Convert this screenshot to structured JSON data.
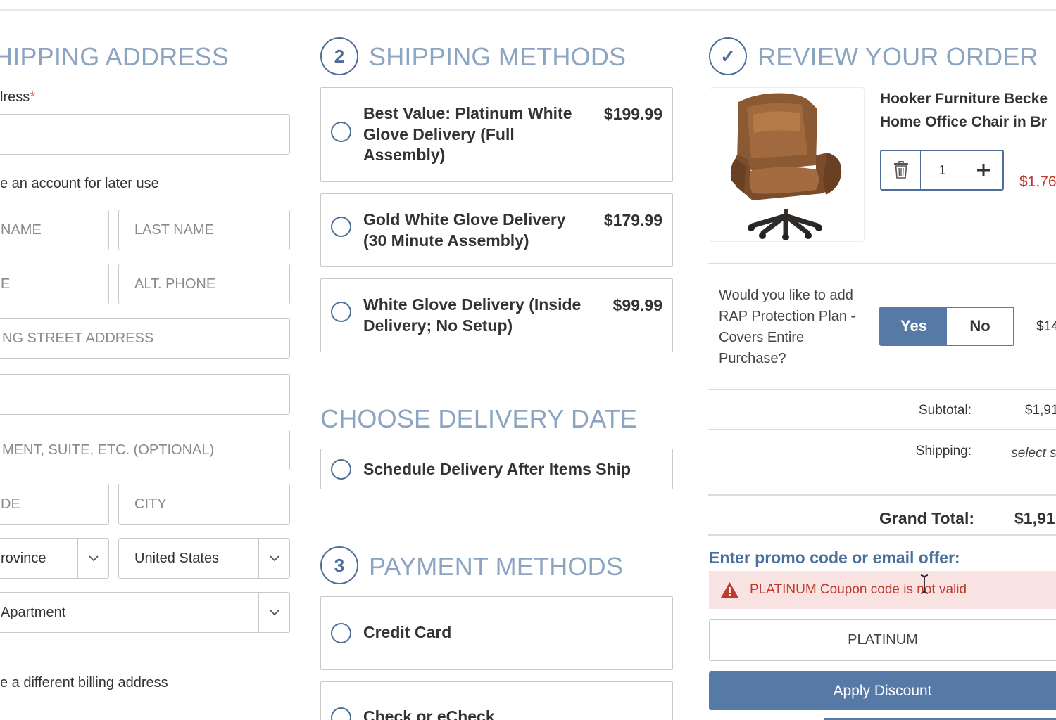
{
  "shipping_address": {
    "heading": "HIPPING ADDRESS",
    "address_label": "lress",
    "required_mark": "*",
    "address_value": "",
    "create_account_text": "e an account for later use",
    "first_name_placeholder": "NAME",
    "last_name_placeholder": "LAST NAME",
    "phone_placeholder": "E",
    "alt_phone_placeholder": "ALT. PHONE",
    "street_placeholder": "NG STREET ADDRESS",
    "street2_value": "",
    "apt_placeholder": "MENT, SUITE, ETC. (OPTIONAL)",
    "zip_placeholder": "DE",
    "city_placeholder": "CITY",
    "state_value": "rovince",
    "country_value": "United States",
    "address_type_value": "Apartment",
    "billing_text": "e a different billing address"
  },
  "shipping_methods": {
    "step": "2",
    "heading": "SHIPPING METHODS",
    "options": [
      {
        "label": "Best Value: Platinum White Glove Delivery (Full Assembly)",
        "price": "$199.99"
      },
      {
        "label": "Gold White Glove Delivery (30 Minute Assembly)",
        "price": "$179.99"
      },
      {
        "label": "White Glove Delivery (Inside Delivery; No Setup)",
        "price": "$99.99"
      }
    ]
  },
  "delivery_date": {
    "heading": "CHOOSE DELIVERY DATE",
    "option": "Schedule Delivery After Items Ship"
  },
  "payment_methods": {
    "step": "3",
    "heading": "PAYMENT METHODS",
    "options": [
      "Credit Card",
      "Check or eCheck"
    ]
  },
  "review": {
    "step": "✓",
    "heading": "REVIEW YOUR ORDER",
    "product_name_line1": "Hooker Furniture Becke",
    "product_name_line2": "Home Office Chair in Br",
    "quantity": "1",
    "product_price": "$1,76",
    "rap_question": "Would you like to add RAP Protection Plan - Covers Entire Purchase?",
    "yes_label": "Yes",
    "no_label": "No",
    "rap_price": "$14",
    "subtotal_label": "Subtotal:",
    "subtotal_value": "$1,91",
    "shipping_label": "Shipping:",
    "shipping_value": "select ship me",
    "grand_total_label": "Grand Total:",
    "grand_total_value": "$1,91",
    "promo_label": "Enter promo code or email offer:",
    "error_text": "PLATINUM Coupon code is not valid",
    "promo_value": "PLATINUM",
    "apply_label": "Apply Discount"
  },
  "colors": {
    "heading": "#8aa4c2",
    "accent": "#4c6e98",
    "button": "#5679a6",
    "error_text": "#c0392b",
    "error_bg": "#f9e2e2"
  },
  "icons": [
    "trash-icon",
    "plus-icon",
    "chevron-down-icon",
    "warning-icon",
    "checkmark-icon",
    "text-cursor-icon"
  ]
}
